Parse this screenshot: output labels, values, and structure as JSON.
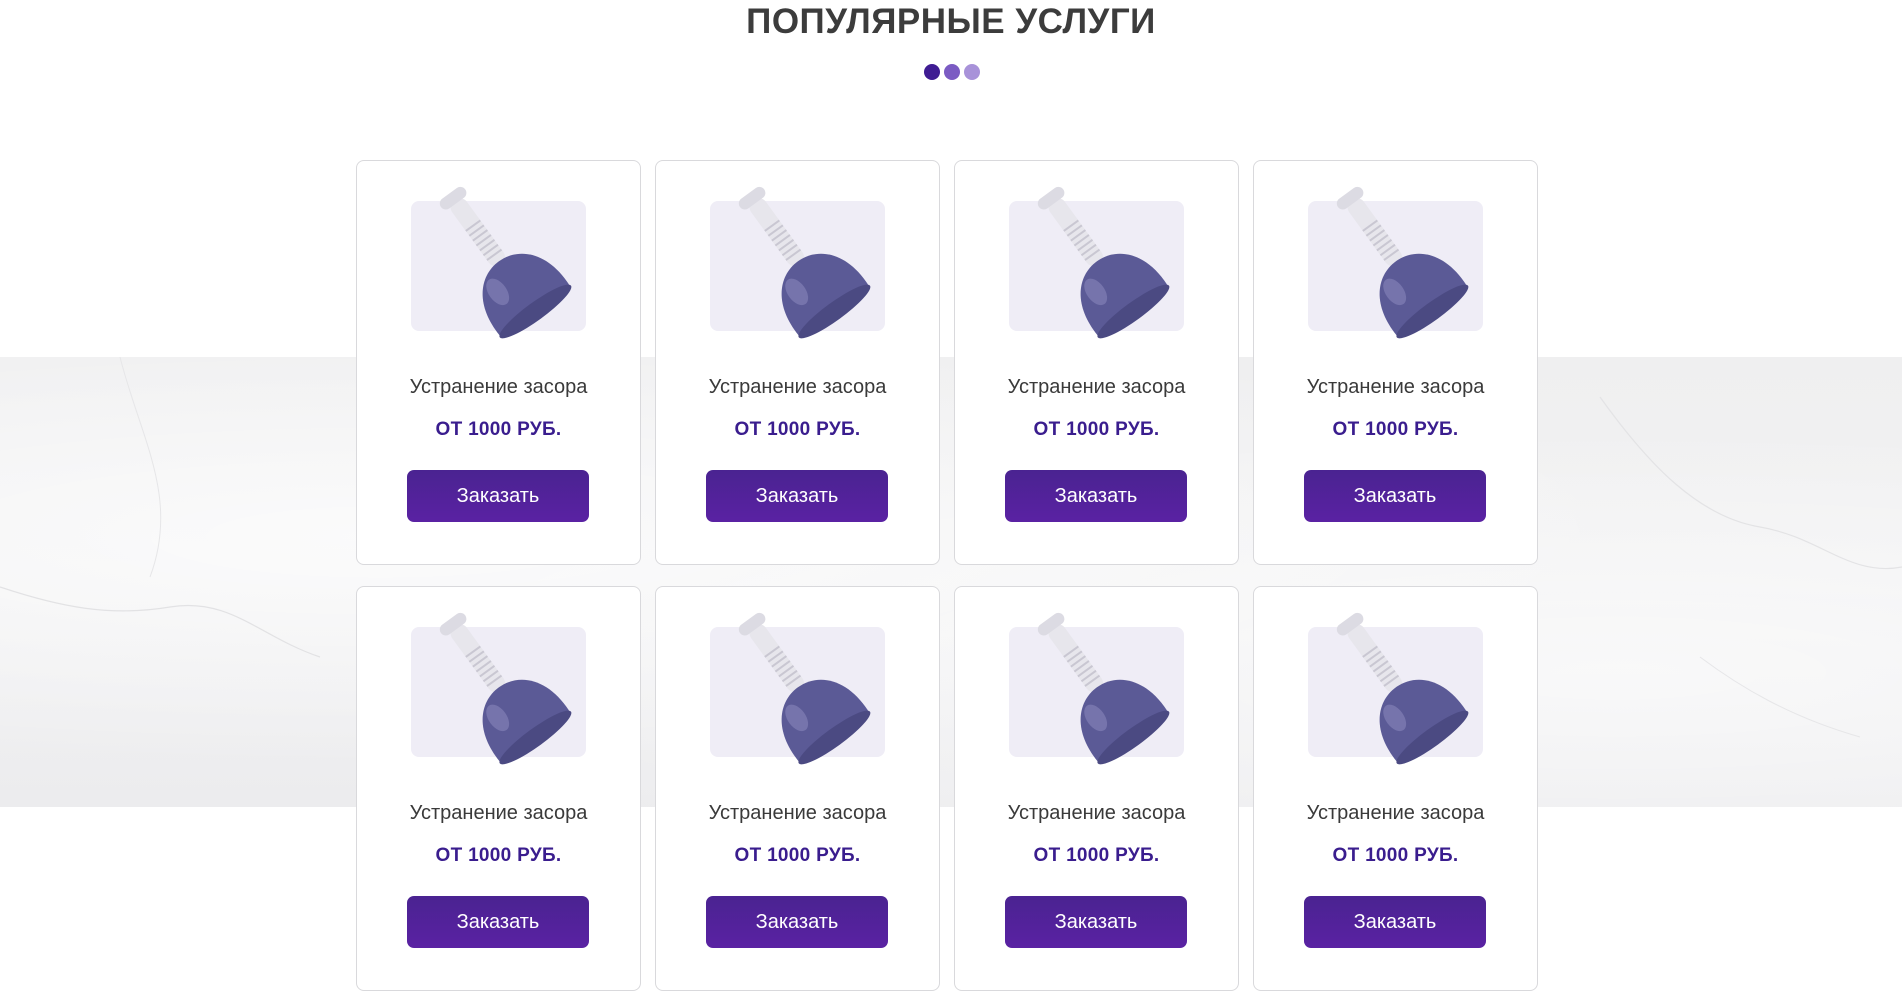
{
  "section": {
    "title": "ПОПУЛЯРНЫЕ УСЛУГИ",
    "decor_dots": [
      "#3f1c93",
      "#7b5bc3",
      "#a892d9"
    ]
  },
  "services": [
    {
      "name": "Устранение засора",
      "price": "ОТ 1000 РУБ.",
      "button": "Заказать",
      "icon": "plunger-icon"
    },
    {
      "name": "Устранение засора",
      "price": "ОТ 1000 РУБ.",
      "button": "Заказать",
      "icon": "plunger-icon"
    },
    {
      "name": "Устранение засора",
      "price": "ОТ 1000 РУБ.",
      "button": "Заказать",
      "icon": "plunger-icon"
    },
    {
      "name": "Устранение засора",
      "price": "ОТ 1000 РУБ.",
      "button": "Заказать",
      "icon": "plunger-icon"
    },
    {
      "name": "Устранение засора",
      "price": "ОТ 1000 РУБ.",
      "button": "Заказать",
      "icon": "plunger-icon"
    },
    {
      "name": "Устранение засора",
      "price": "ОТ 1000 РУБ.",
      "button": "Заказать",
      "icon": "plunger-icon"
    },
    {
      "name": "Устранение засора",
      "price": "ОТ 1000 РУБ.",
      "button": "Заказать",
      "icon": "plunger-icon"
    },
    {
      "name": "Устранение засора",
      "price": "ОТ 1000 РУБ.",
      "button": "Заказать",
      "icon": "plunger-icon"
    }
  ],
  "colors": {
    "accent": "#4a2391",
    "price": "#3a1d8e",
    "thumb_bg": "#efedf6",
    "plunger_cup": "#5b5a96"
  }
}
